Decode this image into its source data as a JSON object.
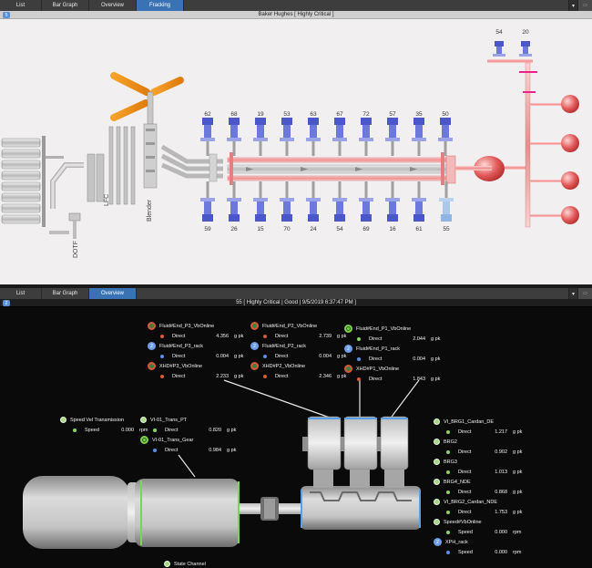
{
  "top_panel": {
    "tabs": [
      {
        "label": "List",
        "active": false
      },
      {
        "label": "Bar Graph",
        "active": false
      },
      {
        "label": "Overview",
        "active": false
      },
      {
        "label": "Fracking",
        "active": true
      }
    ],
    "title": "Baker Hughes  [ Highly Critical ]",
    "badge": "5",
    "controls": {
      "dropdown_icon": "chevron-down-icon",
      "corner_icon": "panel-options-icon"
    },
    "diagram": {
      "labels": {
        "lfc": "LFC",
        "blender": "Blender",
        "dotf": "DOTF"
      },
      "top_pumps": [
        "62",
        "68",
        "19",
        "53",
        "63",
        "67",
        "72",
        "57",
        "35",
        "50"
      ],
      "bottom_pumps": [
        "59",
        "26",
        "15",
        "70",
        "24",
        "54",
        "69",
        "16",
        "61",
        "55"
      ],
      "right_pumps": [
        "54",
        "20"
      ]
    }
  },
  "bottom_panel": {
    "tabs": [
      {
        "label": "List",
        "active": false
      },
      {
        "label": "Bar Graph",
        "active": false
      },
      {
        "label": "Overview",
        "active": true
      }
    ],
    "title": "55  [ Highly Critical | Good | 9/5/2019 6:37:47 PM ]",
    "badge": "2",
    "groups": {
      "p3": {
        "vb": {
          "label": "Fluid#End_P3_VbOnline",
          "direct_label": "Direct",
          "value": "4.356",
          "unit": "g pk"
        },
        "rack": {
          "label": "Fluid#End_P3_rack",
          "direct_label": "Direct",
          "value": "0.004",
          "unit": "g pk"
        },
        "xhd": {
          "label": "XHD#P3_VbOnline",
          "direct_label": "Direct",
          "value": "2.233",
          "unit": "g pk"
        }
      },
      "p2": {
        "vb": {
          "label": "Fluid#End_P2_VbOnline",
          "direct_label": "Direct",
          "value": "2.739",
          "unit": "g pk"
        },
        "rack": {
          "label": "Fluid#End_P2_rack",
          "direct_label": "Direct",
          "value": "0.004",
          "unit": "g pk"
        },
        "xhd": {
          "label": "XHD#P2_VbOnline",
          "direct_label": "Direct",
          "value": "2.346",
          "unit": "g pk"
        }
      },
      "p1": {
        "vb": {
          "label": "Fluid#End_P1_VbOnline",
          "direct_label": "Direct",
          "value": "2.044",
          "unit": "g pk"
        },
        "rack": {
          "label": "Fluid#End_P1_rack",
          "direct_label": "Direct",
          "value": "0.004",
          "unit": "g pk"
        },
        "xhd": {
          "label": "XHD#P1_VbOnline",
          "direct_label": "Direct",
          "value": "1.843",
          "unit": "g pk"
        }
      },
      "speed_vel": {
        "label": "Speed Vel Transmission",
        "speed_label": "Speed",
        "value": "0.000",
        "unit": "rpm"
      },
      "trans": {
        "pt": {
          "label": "VI-01_Trans_PT",
          "direct_label": "Direct",
          "value": "0.820",
          "unit": "g pk"
        },
        "gear": {
          "label": "VI-01_Trans_Gear",
          "direct_label": "Direct",
          "value": "0.984",
          "unit": "g pk"
        }
      },
      "brg": [
        {
          "label": "VI_BRG1_Cardan_DE",
          "sub_label": "Direct",
          "value": "1.217",
          "unit": "g pk",
          "dot": "g",
          "icon": "pin"
        },
        {
          "label": "BRG2",
          "sub_label": "Direct",
          "value": "0.902",
          "unit": "g pk",
          "dot": "g",
          "icon": "pin"
        },
        {
          "label": "BRG3",
          "sub_label": "Direct",
          "value": "1.013",
          "unit": "g pk",
          "dot": "g",
          "icon": "pin"
        },
        {
          "label": "BRG4_NDE",
          "sub_label": "Direct",
          "value": "0.868",
          "unit": "g pk",
          "dot": "g",
          "icon": "pin"
        },
        {
          "label": "VI_BRG2_Cardan_NDE",
          "sub_label": "Direct",
          "value": "1.753",
          "unit": "g pk",
          "dot": "g",
          "icon": "pin"
        },
        {
          "label": "Speed#VbOnline",
          "sub_label": "Speed",
          "value": "0.000",
          "unit": "rpm",
          "dot": "g",
          "icon": "pin"
        },
        {
          "label": "XPH_rack",
          "sub_label": "Speed",
          "value": "0.000",
          "unit": "rpm",
          "dot": "b",
          "icon": "blue"
        }
      ],
      "state": {
        "label": "State Channel"
      }
    },
    "colors": {
      "direct_red": "#d9583a",
      "direct_green": "#8bd36a",
      "rack_blue": "#5a8ee6",
      "accent_tab": "#3a73b5"
    }
  }
}
